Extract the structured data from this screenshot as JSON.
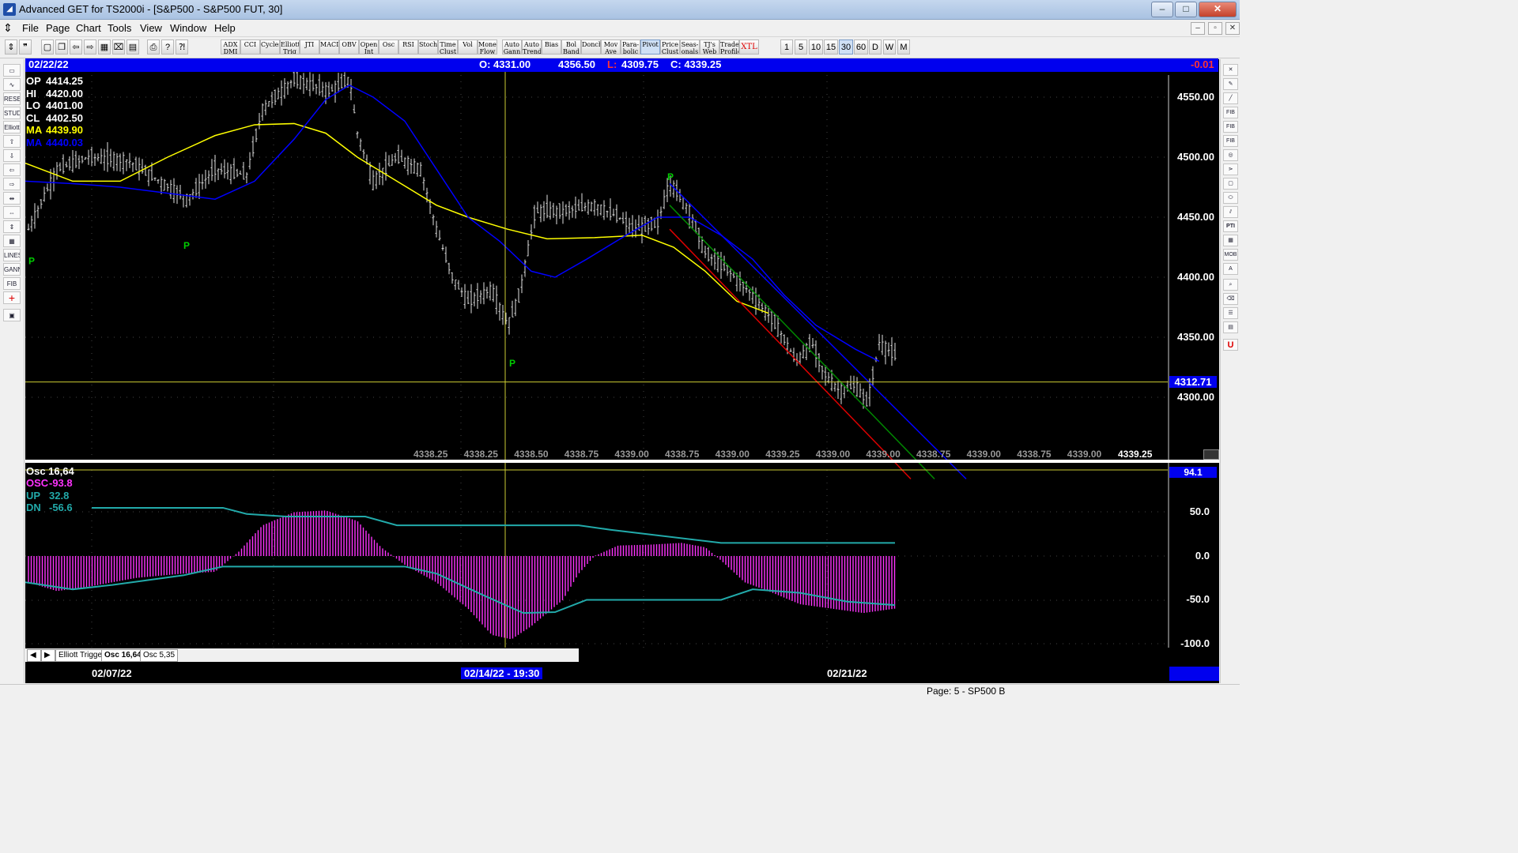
{
  "window": {
    "title": "Advanced GET for TS2000i - [S&P500 - S&P500 FUT, 30]",
    "controls": [
      "–",
      "□",
      "✕"
    ]
  },
  "menu": [
    "File",
    "Page",
    "Chart",
    "Tools",
    "View",
    "Window",
    "Help"
  ],
  "toolbar": {
    "studies": [
      "ADX DMI",
      "CCI",
      "Cycles",
      "Elliott Trig",
      "JTI",
      "MACD",
      "OBV",
      "Open Int",
      "Osc",
      "RSI",
      "Stoch",
      "Time Clust",
      "Vol",
      "Money Flow",
      "Auto Gann",
      "Auto Trend",
      "Bias",
      "Bol Band",
      "Donch",
      "Mov Ave",
      "Para-bolic",
      "Pivot",
      "Price Clust",
      "Seas-onals",
      "TJ's Web",
      "Trade Profile",
      "XTL"
    ],
    "intervals": [
      "1",
      "5",
      "10",
      "15",
      "30",
      "60",
      "D",
      "W",
      "M"
    ],
    "active_interval": "30"
  },
  "info_bar": {
    "date": "02/22/22",
    "open": "O: 4331.00",
    "high": "4356.50",
    "low_label": "L:",
    "low": "4309.75",
    "close": "C: 4339.25",
    "change": "-0.01"
  },
  "price_pane": {
    "readouts": [
      {
        "label": "OP",
        "value": "4414.25",
        "color": "#ffffff"
      },
      {
        "label": "HI",
        "value": "4420.00",
        "color": "#ffffff"
      },
      {
        "label": "LO",
        "value": "4401.00",
        "color": "#ffffff"
      },
      {
        "label": "CL",
        "value": "4402.50",
        "color": "#ffffff"
      },
      {
        "label": "MA",
        "value": "4439.90",
        "color": "#ffff00"
      },
      {
        "label": "MA",
        "value": "4440.03",
        "color": "#0000ff"
      }
    ],
    "y_axis": [
      "4550.00",
      "4500.00",
      "4450.00",
      "4400.00",
      "4350.00",
      "4300.00"
    ],
    "crosshair_price": "4312.71",
    "pivot_marker": "P",
    "bottom_values": [
      "4338.25",
      "4338.25",
      "4338.50",
      "4338.75",
      "4339.00",
      "4338.75",
      "4339.00",
      "4339.25",
      "4339.00",
      "4339.00",
      "4338.75",
      "4339.00",
      "4338.75",
      "4339.00"
    ],
    "last_value": "4339.25"
  },
  "osc_pane": {
    "title": "Osc 16,64",
    "readouts": [
      {
        "label": "OSC",
        "value": "-93.8",
        "color": "#ff33ff"
      },
      {
        "label": "UP",
        "value": "32.8",
        "color": "#22aaaa"
      },
      {
        "label": "DN",
        "value": "-56.6",
        "color": "#22aaaa"
      }
    ],
    "y_axis": [
      "50.0",
      "0.0",
      "-50.0",
      "-100.0"
    ],
    "crosshair_value": "94.1"
  },
  "tabs": [
    "Elliott Trigger",
    "Osc 16,64",
    "Osc 5,35"
  ],
  "date_axis": {
    "labels": [
      "02/07/22",
      "02/21/22"
    ],
    "crosshair_date": "02/14/22 - 19:30"
  },
  "status": "Page: 5 - SP500 B",
  "colors": {
    "background": "#000000",
    "info_bar": "#0000ee",
    "ma_fast": "#ffff00",
    "ma_slow": "#0000ff",
    "oscillator": "#ff33ff",
    "bands": "#22aaaa",
    "crosshair": "#cccc33",
    "pivot": "#00cc00"
  }
}
